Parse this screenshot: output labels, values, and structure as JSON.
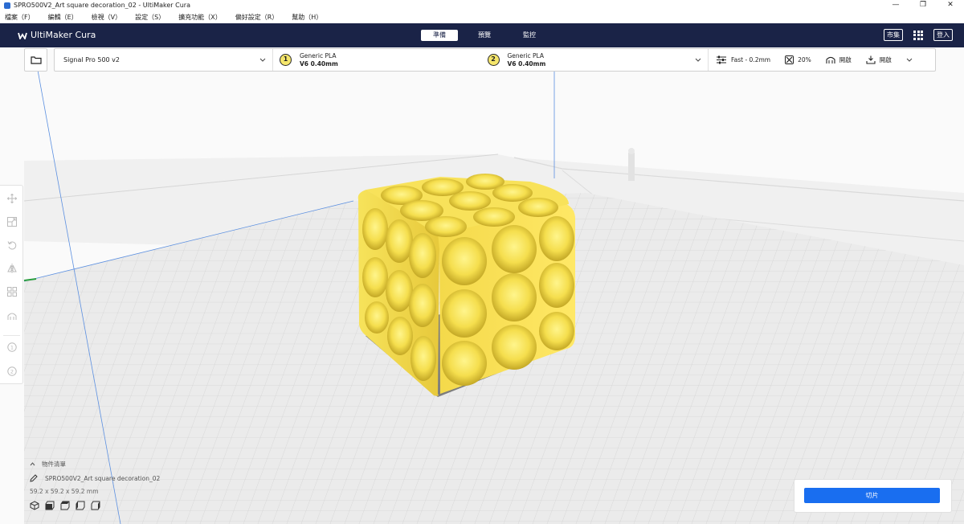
{
  "window": {
    "title": "SPRO500V2_Art square decoration_02 - UltiMaker Cura",
    "controls": [
      "—",
      "❐",
      "✕"
    ]
  },
  "menu": [
    "檔案（F）",
    "編輯（E）",
    "檢視（V）",
    "設定（S）",
    "擴充功能（X）",
    "偏好設定（R）",
    "幫助（H）"
  ],
  "header": {
    "brand": "UltiMaker Cura",
    "tabs": [
      "準備",
      "預覽",
      "監控"
    ],
    "marketplace": "市集",
    "signin": "登入"
  },
  "printer": {
    "name": "Signal Pro 500 v2"
  },
  "extruders": [
    {
      "index": "1",
      "material": "Generic PLA",
      "nozzle": "V6 0.40mm"
    },
    {
      "index": "2",
      "material": "Generic PLA",
      "nozzle": "V6 0.40mm"
    }
  ],
  "print_settings": {
    "profile": "Fast - 0.2mm",
    "infill": "20%",
    "support": "開啟",
    "adhesion": "開啟"
  },
  "object_list": {
    "toggle_label": "物件清單",
    "object_name": "SPRO500V2_Art square decoration_02",
    "dimensions": "59.2 x 59.2 x 59.2 mm"
  },
  "slice": {
    "button": "切片"
  },
  "colors": {
    "header_bg": "#1a2347",
    "accent": "#196ef0",
    "model": "#f2d84a"
  }
}
